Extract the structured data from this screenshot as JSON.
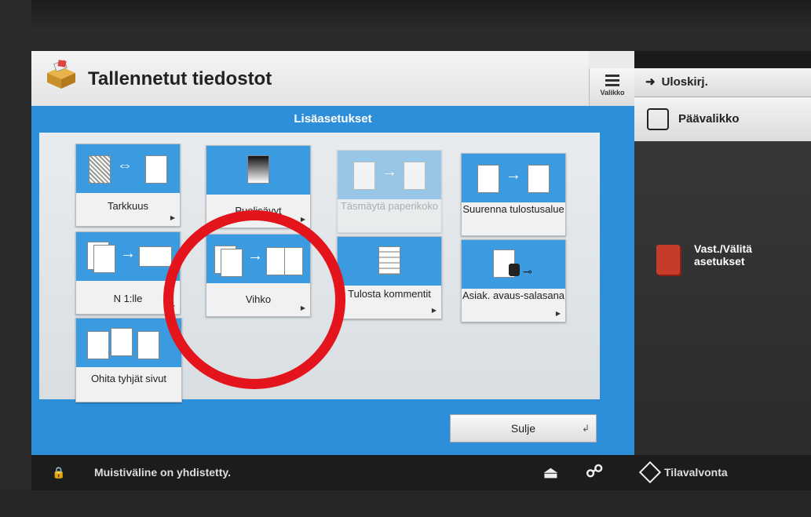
{
  "header": {
    "title": "Tallennetut tiedostot",
    "menu_label": "Valikko"
  },
  "panel": {
    "title": "Lisäasetukset",
    "tiles": [
      {
        "label": "Tarkkuus",
        "enabled": true
      },
      {
        "label": "Puolisävyt",
        "enabled": true
      },
      {
        "label": "Täsmäytä paperikoko",
        "enabled": false
      },
      {
        "label": "Suurenna tulostusalue",
        "enabled": true
      },
      {
        "label": "N 1:lle",
        "enabled": true
      },
      {
        "label": "Vihko",
        "enabled": true
      },
      {
        "label": "Tulosta kommentit",
        "enabled": true
      },
      {
        "label": "Asiak. avaus-salasana",
        "enabled": true
      },
      {
        "label": "Ohita tyhjät sivut",
        "enabled": true
      }
    ],
    "close_label": "Sulje"
  },
  "sidebar": {
    "logout_label": "Uloskirj.",
    "home_label": "Päävalikko",
    "settings_label": "Vast./Välitä asetukset"
  },
  "status": {
    "message": "Muistiväline on yhdistetty.",
    "status_monitor": "Tilavalvonta"
  },
  "accent": "#2d8fd9",
  "annotation_color": "#e4141c"
}
